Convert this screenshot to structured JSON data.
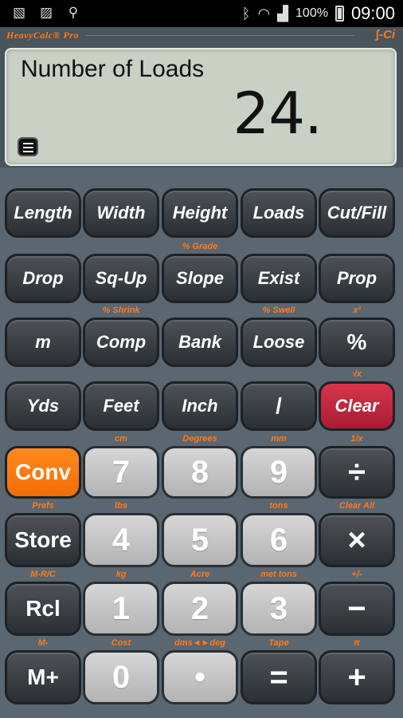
{
  "status_bar": {
    "icons_left": [
      "picture-icon",
      "image-icon",
      "keyhole-icon"
    ],
    "battery": "100%",
    "time": "09:00"
  },
  "brand": {
    "name": "HeavyCalc® Pro",
    "logo": "∫-Ci"
  },
  "display": {
    "label": "Number of Loads",
    "value": "24."
  },
  "rows": [
    [
      {
        "label": "Length"
      },
      {
        "label": "Width"
      },
      {
        "label": "Height"
      },
      {
        "label": "Loads"
      },
      {
        "label": "Cut/Fill"
      }
    ],
    [
      {
        "label": "Drop"
      },
      {
        "label": "Sq-Up"
      },
      {
        "label": "Slope",
        "sub": "% Grade"
      },
      {
        "label": "Exist"
      },
      {
        "label": "Prop"
      }
    ],
    [
      {
        "label": "m"
      },
      {
        "label": "Comp",
        "sub": "% Shrink"
      },
      {
        "label": "Bank"
      },
      {
        "label": "Loose",
        "sub": "% Swell"
      },
      {
        "label": "%",
        "sub": "x²"
      }
    ],
    [
      {
        "label": "Yds"
      },
      {
        "label": "Feet"
      },
      {
        "label": "Inch"
      },
      {
        "label": "/"
      },
      {
        "label": "Clear",
        "sub": "√x"
      }
    ],
    [
      {
        "label": "Conv"
      },
      {
        "label": "7",
        "sub": "cm"
      },
      {
        "label": "8",
        "sub": "Degrees"
      },
      {
        "label": "9",
        "sub": "mm"
      },
      {
        "label": "÷",
        "sub": "1/x"
      }
    ],
    [
      {
        "label": "Store",
        "sub": "Prefs"
      },
      {
        "label": "4",
        "sub": "lbs"
      },
      {
        "label": "5"
      },
      {
        "label": "6",
        "sub": "tons"
      },
      {
        "label": "×",
        "sub": "Clear All"
      }
    ],
    [
      {
        "label": "Rcl",
        "sub": "M-R/C"
      },
      {
        "label": "1",
        "sub": "kg"
      },
      {
        "label": "2",
        "sub": "Acre"
      },
      {
        "label": "3",
        "sub": "met tons"
      },
      {
        "label": "−",
        "sub": "+/-"
      }
    ],
    [
      {
        "label": "M+",
        "sub": "M-"
      },
      {
        "label": "0",
        "sub": "Cost"
      },
      {
        "label": "•",
        "sub": "dms◄►deg"
      },
      {
        "label": "=",
        "sub": "Tape"
      },
      {
        "label": "+",
        "sub": "π"
      }
    ]
  ],
  "colors": {
    "accent": "#ff7a1a",
    "clear": "#c22940",
    "conv": "#f57208",
    "digit": "#c4c4c4",
    "function": "#3a4045",
    "body": "#5a6670"
  }
}
